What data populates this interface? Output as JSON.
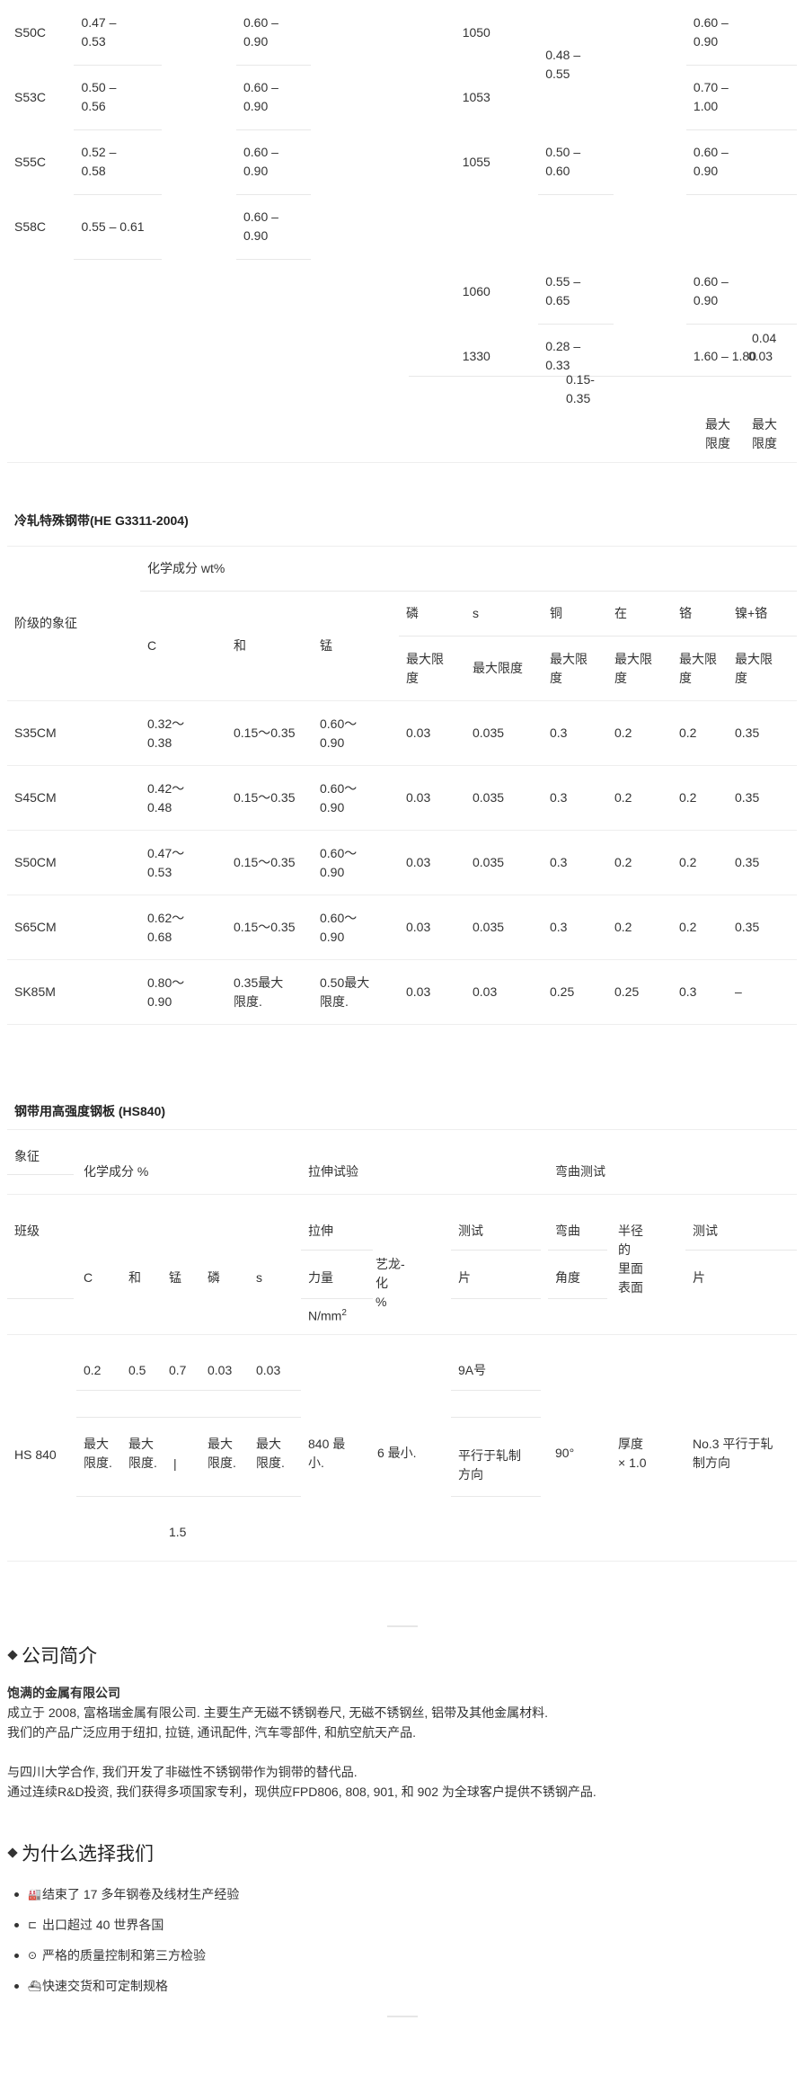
{
  "table1": {
    "rows": [
      {
        "grade": "S50C",
        "c": "0.47 –\n0.53",
        "mn": "0.60 –\n0.90",
        "aisi": "1050",
        "c2": "0.48 –\n0.55",
        "mn2": "0.60 –\n0.90",
        "p": "",
        "s": ""
      },
      {
        "grade": "S53C",
        "c": "0.50 –\n0.56",
        "mn": "0.60 –\n0.90",
        "aisi": "1053",
        "c2": "",
        "mn2": "0.70 –\n1.00",
        "p": "",
        "s": ""
      },
      {
        "grade": "S55C",
        "c": "0.52 –\n0.58",
        "mn": "0.60 –\n0.90",
        "aisi": "1055",
        "c2": "0.50 –\n0.60",
        "mn2": "0.60 –\n0.90",
        "p": "",
        "s": ""
      },
      {
        "grade": "S58C",
        "c": "0.55 – 0.61",
        "mn": "0.60 –\n0.90",
        "aisi": "",
        "c2": "",
        "mn2": "",
        "p": "",
        "s": ""
      },
      {
        "grade": "",
        "c": "",
        "mn": "",
        "aisi": "1060",
        "c2": "0.55 –\n0.65",
        "mn2": "0.60 –\n0.90",
        "p": "",
        "s": ""
      },
      {
        "grade": "",
        "c": "",
        "mn": "",
        "aisi": "1330",
        "c2": "0.28 –\n0.33",
        "mn2": "1.60 – 1.80",
        "p": "0.03",
        "s": "0.04"
      }
    ],
    "si": "0.15-\n0.35",
    "max_p": "最大\n限度",
    "max_s": "最大\n限度"
  },
  "table2": {
    "title": "冷轧特殊钢带(HE G3311-2004)",
    "chem_header": "化学成分 wt%",
    "grade_header": "阶级的象征",
    "col_c": "C",
    "col_si": "和",
    "col_mn": "锰",
    "col_p": "磷",
    "col_s": "s",
    "col_cu": "铜",
    "col_ni": "在",
    "col_cr": "铬",
    "col_nicr": "镍+铬",
    "max_limit_a": "最大限\n度",
    "max_limit_b": "最大限度",
    "max_limit_c": "最大限\n度",
    "rows": [
      {
        "grade": "S35CM",
        "c": "0.32～\n0.38",
        "si": "0.15～0.35",
        "mn": "0.60～\n0.90",
        "p": "0.03",
        "s": "0.035",
        "cu": "0.3",
        "ni": "0.2",
        "cr": "0.2",
        "nicr": "0.35"
      },
      {
        "grade": "S45CM",
        "c": "0.42～\n0.48",
        "si": "0.15～0.35",
        "mn": "0.60～\n0.90",
        "p": "0.03",
        "s": "0.035",
        "cu": "0.3",
        "ni": "0.2",
        "cr": "0.2",
        "nicr": "0.35"
      },
      {
        "grade": "S50CM",
        "c": "0.47～\n0.53",
        "si": "0.15～0.35",
        "mn": "0.60～\n0.90",
        "p": "0.03",
        "s": "0.035",
        "cu": "0.3",
        "ni": "0.2",
        "cr": "0.2",
        "nicr": "0.35"
      },
      {
        "grade": "S65CM",
        "c": "0.62～\n0.68",
        "si": "0.15～0.35",
        "mn": "0.60～\n0.90",
        "p": "0.03",
        "s": "0.035",
        "cu": "0.3",
        "ni": "0.2",
        "cr": "0.2",
        "nicr": "0.35"
      },
      {
        "grade": "SK85M",
        "c": "0.80～\n0.90",
        "si": "0.35最大\n限度.",
        "mn": "0.50最大\n限度.",
        "p": "0.03",
        "s": "0.03",
        "cu": "0.25",
        "ni": "0.25",
        "cr": "0.3",
        "nicr": "–"
      }
    ]
  },
  "table3": {
    "title": "钢带用高强度钢板 (HS840)",
    "symbol": "象征",
    "chem": "化学成分 %",
    "tensile": "拉伸试验",
    "bend": "弯曲测试",
    "class": "班级",
    "stretch": "拉伸",
    "test1": "测试",
    "bend2": "弯曲",
    "radius": "半径\n的\n里面\n表面",
    "test2": "测试",
    "c": "C",
    "si": "和",
    "mn": "锰",
    "p": "磷",
    "s": "s",
    "force": "力量",
    "elong": "艺龙-\n化\n%",
    "piece1": "片",
    "angle": "角度",
    "piece2": "片",
    "unit": "N/mm",
    "unit_sup": "2",
    "v_c": "0.2",
    "v_si": "0.5",
    "v_mn": "0.7",
    "v_p": "0.03",
    "v_s": "0.03",
    "no9a": "9A号",
    "grade": "HS 840",
    "max_c": "最大\n限度.",
    "max_si": "最大\n限度.",
    "bar": "|",
    "max_p": "最大\n限度.",
    "max_s": "最大\n限度.",
    "tensile_val": "840 最\n小.",
    "elong_val": "6 最小.",
    "parallel1": "平行于轧制\n方向",
    "angle_val": "90°",
    "thick": "厚度\n× 1.0",
    "parallel2": "No.3 平行于轧\n制方向",
    "mn_max": "1.5"
  },
  "about": {
    "heading": "公司简介",
    "company": "饱满的金属有限公司",
    "p1": "成立于 2008, 富格瑞金属有限公司. 主要生产无磁不锈钢卷尺, 无磁不锈钢丝, 铝带及其他金属材料.",
    "p2": "我们的产品广泛应用于纽扣, 拉链, 通讯配件, 汽车零部件, 和航空航天产品.",
    "p3": "与四川大学合作, 我们开发了非磁性不锈钢带作为铜带的替代品.",
    "p4": "通过连续R&D投资, 我们获得多项国家专利，现供应FPD806, 808, 901, 和 902 为全球客户提供不锈钢产品."
  },
  "why": {
    "heading": "为什么选择我们",
    "items": [
      {
        "icon": "factory-icon",
        "glyph": "🏭",
        "text": "结束了 17 多年钢卷及线材生产经验"
      },
      {
        "icon": "box-icon",
        "glyph": "⊏",
        "text": "出口超过 40 世界各国"
      },
      {
        "icon": "check-icon",
        "glyph": "⊙",
        "text": "严格的质量控制和第三方检验"
      },
      {
        "icon": "ship-icon",
        "glyph": "⛴",
        "text": "快速交货和可定制规格"
      }
    ]
  }
}
